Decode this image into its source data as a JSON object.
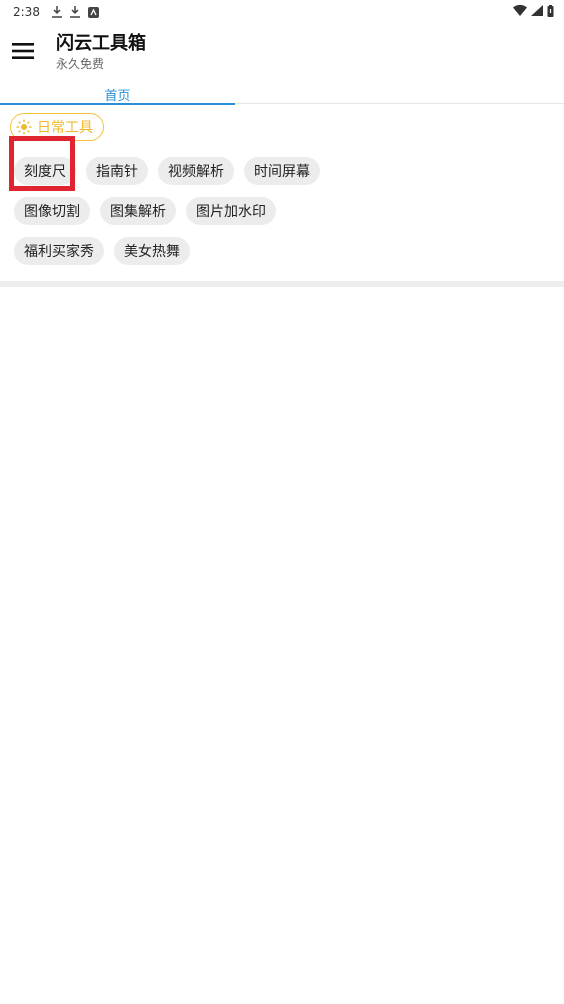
{
  "status_bar": {
    "time": "2:38"
  },
  "app_bar": {
    "title": "闪云工具箱",
    "subtitle": "永久免费"
  },
  "tabs": [
    {
      "label": "首页",
      "active": true
    }
  ],
  "category": {
    "label": "日常工具",
    "color": "#f0b82c"
  },
  "tools": [
    [
      "刻度尺",
      "指南针",
      "视频解析",
      "时间屏幕"
    ],
    [
      "图像切割",
      "图集解析",
      "图片加水印"
    ],
    [
      "福利买家秀",
      "美女热舞"
    ]
  ],
  "colors": {
    "accent": "#2b8fd6",
    "highlight": "#e12530",
    "chip_bg": "#ececec"
  }
}
